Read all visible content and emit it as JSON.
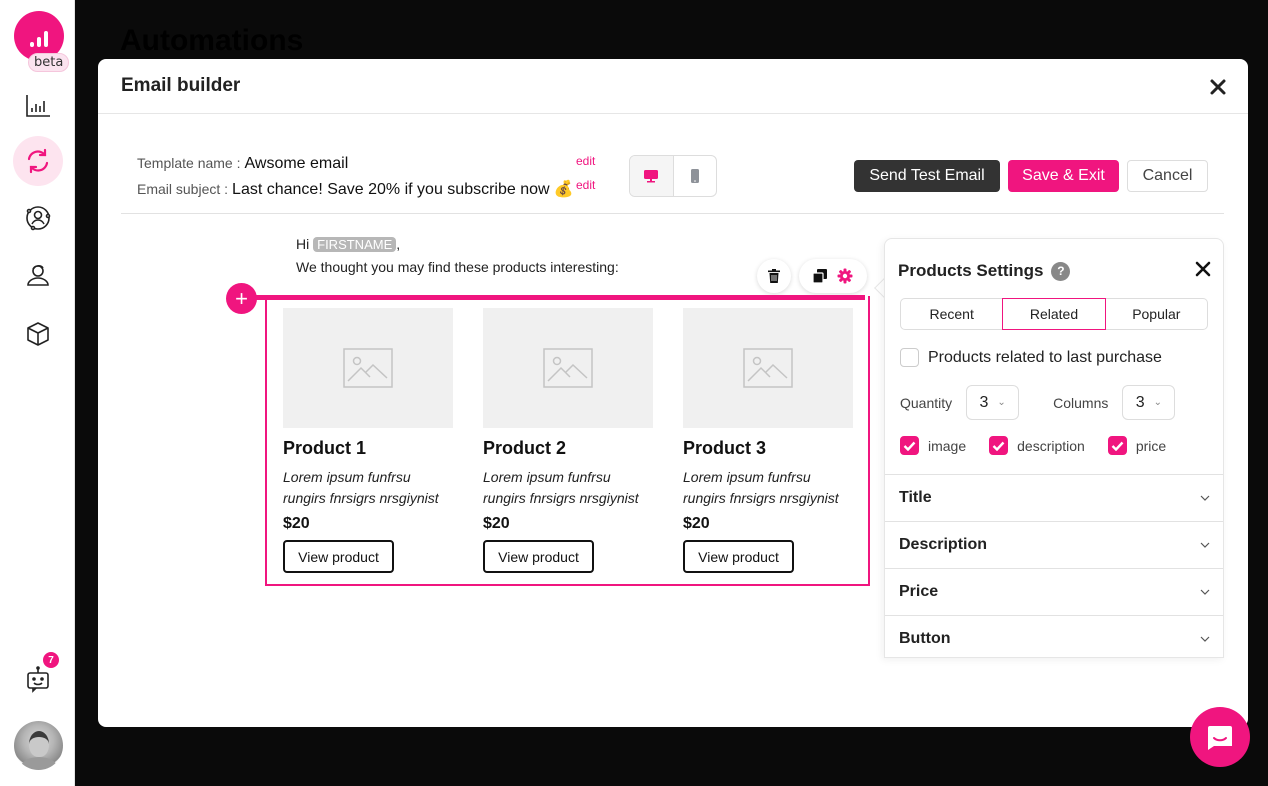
{
  "background_page": {
    "title": "Automations"
  },
  "sidebar": {
    "logo_badge": "beta",
    "items": [
      {
        "name": "analytics",
        "icon": "bar-chart-icon",
        "active": false
      },
      {
        "name": "automations",
        "icon": "sync-icon",
        "active": true
      },
      {
        "name": "contacts",
        "icon": "user-circle-icon",
        "active": false
      },
      {
        "name": "audience",
        "icon": "user-cap-icon",
        "active": false
      },
      {
        "name": "products",
        "icon": "cube-icon",
        "active": false
      }
    ],
    "bot": {
      "icon": "bot-icon",
      "badge_count": "7"
    },
    "avatar": "user-avatar"
  },
  "modal": {
    "title": "Email builder",
    "template_name_label": "Template name :",
    "template_name_value": "Awsome email",
    "email_subject_label": "Email subject :",
    "email_subject_value": "Last chance! Save 20% if you subscribe now",
    "email_subject_emoji": "💰",
    "edit_label": "edit",
    "device_toggle": {
      "selected": "desktop",
      "options": [
        "desktop",
        "mobile"
      ]
    },
    "buttons": {
      "send_test": "Send Test Email",
      "save_exit": "Save & Exit",
      "cancel": "Cancel"
    }
  },
  "email": {
    "greeting_prefix": "Hi",
    "firstname_tag": "FIRSTNAME",
    "greeting_suffix": ",",
    "intro": "We thought you may find these products interesting:",
    "products": [
      {
        "name": "Product 1",
        "description": "Lorem ipsum funfrsu rungirs fnrsigrs nrsgiynist",
        "price": "$20",
        "button": "View product"
      },
      {
        "name": "Product 2",
        "description": "Lorem ipsum funfrsu rungirs fnrsigrs nrsgiynist",
        "price": "$20",
        "button": "View product"
      },
      {
        "name": "Product 3",
        "description": "Lorem ipsum funfrsu rungirs fnrsigrs nrsgiynist",
        "price": "$20",
        "button": "View product"
      }
    ]
  },
  "settings": {
    "title": "Products Settings",
    "help": "?",
    "tabs": [
      {
        "label": "Recent",
        "active": false
      },
      {
        "label": "Related",
        "active": true
      },
      {
        "label": "Popular",
        "active": false
      }
    ],
    "related_checkbox": {
      "label": "Products related to last purchase",
      "checked": false
    },
    "quantity": {
      "label": "Quantity",
      "value": "3"
    },
    "columns": {
      "label": "Columns",
      "value": "3"
    },
    "display_options": [
      {
        "label": "image",
        "checked": true
      },
      {
        "label": "description",
        "checked": true
      },
      {
        "label": "price",
        "checked": true
      }
    ],
    "sections": [
      "Title",
      "Description",
      "Price",
      "Button"
    ]
  },
  "colors": {
    "accent": "#f0157f",
    "dark_button": "#333333",
    "tag": "#b7b7b7"
  }
}
